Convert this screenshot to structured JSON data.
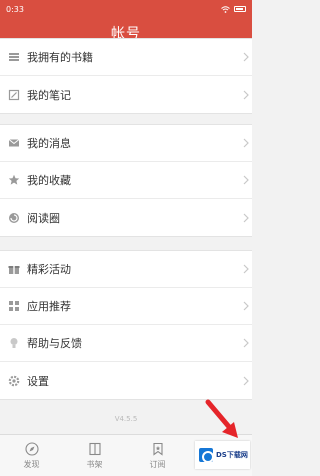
{
  "status_bar": {
    "time": "0:33",
    "battery": "battery-icon",
    "wifi": "wifi-icon"
  },
  "header": {
    "title": "帐号"
  },
  "groups": [
    {
      "items": [
        {
          "label": "我拥有的书籍",
          "icon": "bookshelf-icon"
        },
        {
          "label": "我的笔记",
          "icon": "note-icon"
        }
      ]
    },
    {
      "items": [
        {
          "label": "我的消息",
          "icon": "mail-icon"
        },
        {
          "label": "我的收藏",
          "icon": "star-icon"
        },
        {
          "label": "阅读圈",
          "icon": "circle-icon"
        }
      ]
    },
    {
      "items": [
        {
          "label": "精彩活动",
          "icon": "gift-icon"
        },
        {
          "label": "应用推荐",
          "icon": "apps-icon"
        },
        {
          "label": "帮助与反馈",
          "icon": "bulb-icon"
        },
        {
          "label": "设置",
          "icon": "gear-icon"
        }
      ]
    }
  ],
  "version": "V4.5.5",
  "tabs": [
    {
      "label": "发现",
      "icon": "compass-icon"
    },
    {
      "label": "书架",
      "icon": "book-icon"
    },
    {
      "label": "订阅",
      "icon": "bookmark-icon"
    }
  ],
  "watermark": {
    "text": "DS下载网"
  },
  "colors": {
    "primary": "#d94e40",
    "annotation_arrow": "#e5252a"
  }
}
